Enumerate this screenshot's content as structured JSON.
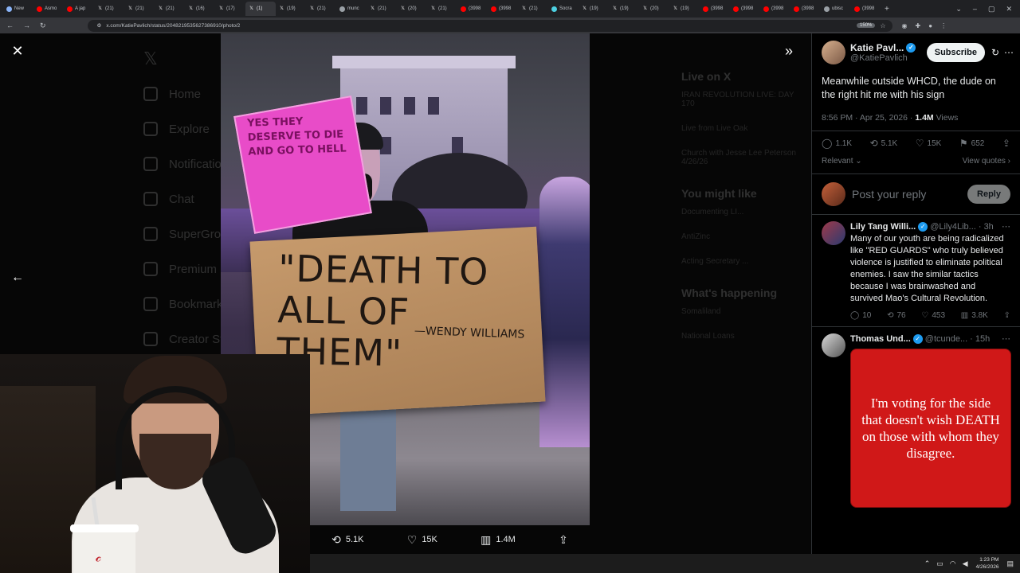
{
  "browser": {
    "tabs": [
      {
        "label": "New",
        "icon": "chrome-icon",
        "color": "#8ab4f8"
      },
      {
        "label": "Asmo",
        "icon": "youtube-icon",
        "color": "#ff0000"
      },
      {
        "label": "A jap",
        "icon": "youtube-icon",
        "color": "#ff0000"
      },
      {
        "label": "(21)",
        "icon": "x-icon",
        "color": "#ffffff"
      },
      {
        "label": "(21)",
        "icon": "x-icon",
        "color": "#ffffff"
      },
      {
        "label": "(21)",
        "icon": "x-icon",
        "color": "#ffffff"
      },
      {
        "label": "(16)",
        "icon": "x-icon",
        "color": "#ffffff"
      },
      {
        "label": "(17)",
        "icon": "x-icon",
        "color": "#ffffff"
      },
      {
        "label": "(1)",
        "icon": "x-icon",
        "color": "#ffffff",
        "active": true
      },
      {
        "label": "(19)",
        "icon": "x-icon",
        "color": "#ffffff"
      },
      {
        "label": "(21)",
        "icon": "x-icon",
        "color": "#ffffff"
      },
      {
        "label": "munc",
        "icon": "globe-icon",
        "color": "#9aa0a6"
      },
      {
        "label": "(21)",
        "icon": "x-icon",
        "color": "#ffffff"
      },
      {
        "label": "(20)",
        "icon": "x-icon",
        "color": "#ffffff"
      },
      {
        "label": "(21)",
        "icon": "x-icon",
        "color": "#ffffff"
      },
      {
        "label": "(3998",
        "icon": "youtube-icon",
        "color": "#ff0000"
      },
      {
        "label": "(3998",
        "icon": "youtube-icon",
        "color": "#ff0000"
      },
      {
        "label": "(21)",
        "icon": "x-icon",
        "color": "#ffffff"
      },
      {
        "label": "Socra",
        "icon": "socra-icon",
        "color": "#4dd0e1"
      },
      {
        "label": "(19)",
        "icon": "x-icon",
        "color": "#ffffff"
      },
      {
        "label": "(19)",
        "icon": "x-icon",
        "color": "#ffffff"
      },
      {
        "label": "(20)",
        "icon": "x-icon",
        "color": "#ffffff"
      },
      {
        "label": "(19)",
        "icon": "x-icon",
        "color": "#ffffff"
      },
      {
        "label": "(3998",
        "icon": "youtube-icon",
        "color": "#ff0000"
      },
      {
        "label": "(3998",
        "icon": "youtube-icon",
        "color": "#ff0000"
      },
      {
        "label": "(3998",
        "icon": "youtube-icon",
        "color": "#ff0000"
      },
      {
        "label": "(3998",
        "icon": "youtube-icon",
        "color": "#ff0000"
      },
      {
        "label": "ubisc",
        "icon": "globe-icon",
        "color": "#9aa0a6"
      },
      {
        "label": "(3998",
        "icon": "youtube-icon",
        "color": "#ff0000"
      }
    ],
    "url": "x.com/KatiePavlich/status/2048219535627386910/photo/2",
    "zoom": "150%"
  },
  "dimmed": {
    "nav": [
      "Home",
      "Explore",
      "Notifications",
      "Chat",
      "SuperGrok",
      "Premium",
      "Bookmarks",
      "Creator Studio"
    ],
    "right_sections": [
      {
        "title": "Live on X",
        "rows": [
          "IRAN REVOLUTION LIVE: DAY 170",
          "Live from Live Oak",
          "Church with Jesse Lee Peterson 4/26/26"
        ]
      },
      {
        "title": "You might like",
        "rows": [
          "Documenting LI...",
          "AntiZinc",
          "Acting Secretary ..."
        ]
      },
      {
        "title": "What's happening",
        "rows": [
          "Somaliland",
          "National Loans"
        ]
      }
    ]
  },
  "photo": {
    "sign_text": "\"DEATH TO ALL OF THEM\"",
    "sign_attrib": "—WENDY WILLIAMS",
    "pink_sign_text": "YES THEY DESERVE TO DIE AND GO TO HELL",
    "actions": {
      "retweets": "5.1K",
      "likes": "15K",
      "views": "1.4M"
    }
  },
  "tweet": {
    "display_name": "Katie Pavl...",
    "handle": "@KatiePavlich",
    "subscribe_label": "Subscribe",
    "text": "Meanwhile outside WHCD, the dude on the right hit me with his sign",
    "time": "8:56 PM · Apr 25, 2026 · ",
    "views_count": "1.4M",
    "views_label": " Views",
    "stats": {
      "replies": "1.1K",
      "retweets": "5.1K",
      "likes": "15K",
      "bookmarks": "652"
    },
    "relevant_label": "Relevant",
    "view_quotes_label": "View quotes"
  },
  "reply_box": {
    "placeholder": "Post your reply",
    "button_label": "Reply"
  },
  "replies": [
    {
      "name": "Lily Tang Willi...",
      "handle": "@Lily4Lib...",
      "time": "· 3h",
      "text": "Many of our youth are being radicalized like \"RED GUARDS\" who truly believed violence is justified to eliminate political enemies. I saw the similar tactics because I was brainwashed and survived Mao's Cultural Revolution.",
      "replies": "10",
      "retweets": "76",
      "likes": "453",
      "views": "3.8K"
    },
    {
      "name": "Thomas Und...",
      "handle": "@tcunde...",
      "time": "· 15h",
      "image_text": "I'm voting for the side that doesn't wish DEATH on those with whom they disagree."
    }
  ],
  "taskbar": {
    "time": "1:23 PM",
    "date": "4/26/2026"
  }
}
